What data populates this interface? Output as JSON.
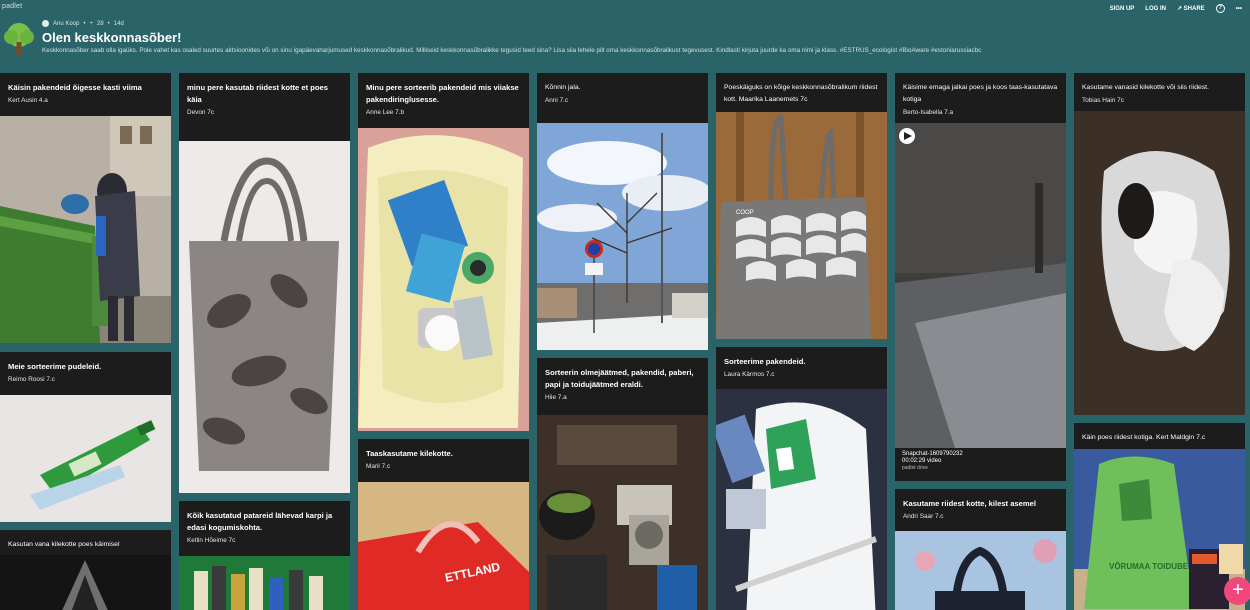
{
  "app": {
    "brand": "padlet"
  },
  "toplinks": {
    "signup": "SIGN UP",
    "login": "LOG IN",
    "share": "SHARE"
  },
  "header": {
    "author": "Anu Koop",
    "likes": "28",
    "age": "14d",
    "title": "Olen keskkonnasõber!",
    "description": "Keskkonnasõber saab olla igaüks. Pole vahet kas osaled suurtes aktsioonides või on sinu igapäevaharjumused keskkonnasõbralikud. Milliseid keskkonnasõbralikke tegusid teed sina? Lisa siia lehele pilt oma keskkonnasõbralikust tegevusest. Kindlasti kirjuta juurde ka oma nimi ja klass. #ESTRUS_ecologist #BioAware #estoniarussiacbc"
  },
  "columns": [
    [
      {
        "title": "Käisin pakendeid õigesse kasti viima",
        "author": "Kert Ausin 4.a"
      },
      {
        "title": "Meie sorteerime pudeleid.",
        "author": "Reimo Roosi 7.c"
      },
      {
        "title": "Kasutan vana kilekotte poes käimisel",
        "author": ""
      }
    ],
    [
      {
        "title": "minu pere kasutab riidest kotte et poes käia",
        "author": "Devon 7c"
      },
      {
        "title": "Kõik kasutatud patareid lähevad karpi ja edasi kogumiskohta.",
        "author": "Ketlin Hõeime 7c"
      }
    ],
    [
      {
        "title": "Minu pere sorteerib pakendeid mis viiakse pakendiringlusesse.",
        "author": "Anne Lee 7.b"
      },
      {
        "title": "Taaskasutame kilekotte.",
        "author": "Maril 7.c"
      }
    ],
    [
      {
        "title": "Kõnnin jala.",
        "author": "Anni 7.c"
      },
      {
        "title": "Sorteerin olmejäätmed, pakendid, paberi, papi ja toidujäätmed eraldi.",
        "author": "Hiie 7.a"
      }
    ],
    [
      {
        "title": "Poeskäiguks on kõige keskkonnasõbralikum riidest kott. Maarika Laanemets 7c",
        "author": ""
      },
      {
        "title": "Sorteerime pakendeid.",
        "author": "Laura Kärmos 7.c"
      }
    ],
    [
      {
        "title": "Käisime emaga jalkai poes ja koos taas-kasutatava kotiga",
        "author": "Berto-Isabella 7.a"
      },
      {
        "title": "Kasutame riidest kotte, kilest asemel",
        "author": "Andri Saar 7.c"
      }
    ],
    [
      {
        "title": "Kasutame vanasid kilekotte või siis riidest.",
        "author": "Tobias Hain 7c"
      },
      {
        "title": "Käin poes riidest kotiga. Kert Maldgin 7.c",
        "author": ""
      }
    ]
  ],
  "video": {
    "name": "Snapchat-1609790232",
    "info": "00:02:29 video",
    "source": "padlet drive"
  },
  "images": {
    "text_bag_brand": "COOP",
    "text_bag_brand2": "VÕRUMAA TOIDUBEST",
    "text_plastic_bag": "ETTLAND"
  }
}
